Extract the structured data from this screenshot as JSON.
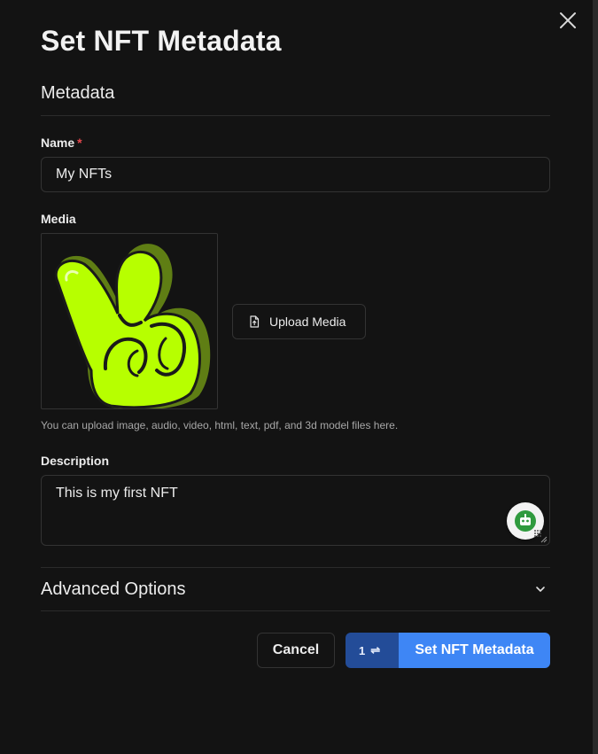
{
  "dialog": {
    "title": "Set NFT Metadata",
    "section_heading": "Metadata"
  },
  "form": {
    "name_label": "Name",
    "name_required_mark": "*",
    "name_value": "My NFTs",
    "media_label": "Media",
    "upload_button": "Upload Media",
    "media_hint": "You can upload image, audio, video, html, text, pdf, and 3d model files here.",
    "description_label": "Description",
    "description_value": "This is my first NFT"
  },
  "advanced": {
    "label": "Advanced Options"
  },
  "footer": {
    "cancel": "Cancel",
    "tx_count": "1",
    "submit": "Set NFT Metadata"
  },
  "icons": {
    "close": "close-icon",
    "upload": "file-upload-icon",
    "chevron": "chevron-down-icon",
    "swap": "swap-icon",
    "assistant": "assistant-robot-icon"
  },
  "colors": {
    "background": "#131313",
    "accent": "#3e86f5",
    "accent_dark": "#234c98",
    "required": "#e5484d",
    "media_green": "#b7ff00"
  }
}
